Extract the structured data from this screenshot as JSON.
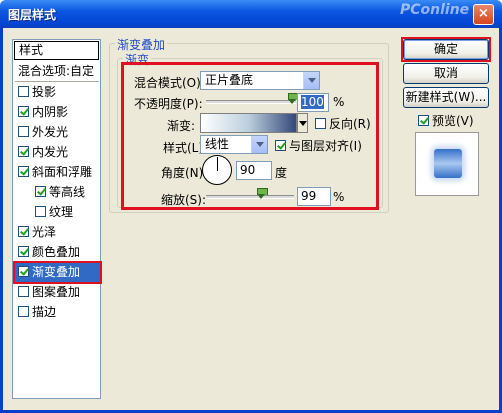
{
  "window": {
    "title": "图层样式",
    "watermark": "PConline",
    "close": "×"
  },
  "sidebar": {
    "header": "样式",
    "blend_options": "混合选项:自定",
    "items": [
      {
        "label": "投影",
        "checked": false
      },
      {
        "label": "内阴影",
        "checked": true
      },
      {
        "label": "外发光",
        "checked": false
      },
      {
        "label": "内发光",
        "checked": true
      },
      {
        "label": "斜面和浮雕",
        "checked": true
      },
      {
        "label": "等高线",
        "checked": true
      },
      {
        "label": "纹理",
        "checked": false
      },
      {
        "label": "光泽",
        "checked": true
      },
      {
        "label": "颜色叠加",
        "checked": true
      },
      {
        "label": "渐变叠加",
        "checked": true,
        "selected": true
      },
      {
        "label": "图案叠加",
        "checked": false
      },
      {
        "label": "描边",
        "checked": false
      }
    ]
  },
  "panel": {
    "outer_legend": "渐变叠加",
    "inner_legend": "渐变",
    "blend_mode_label": "混合模式(O):",
    "blend_mode_value": "正片叠底",
    "opacity_label": "不透明度(P):",
    "opacity_value": "100",
    "opacity_unit": "%",
    "opacity_level": 1.0,
    "gradient_label": "渐变:",
    "reverse_label": "反向(R)",
    "reverse_checked": false,
    "style_label": "样式(L):",
    "style_value": "线性",
    "align_label": "与图层对齐(I)",
    "align_checked": true,
    "angle_label": "角度(N):",
    "angle_value": "90",
    "angle_unit": "度",
    "scale_label": "缩放(S):",
    "scale_value": "99",
    "scale_unit": "%",
    "scale_level": 0.66
  },
  "buttons": {
    "ok": "确定",
    "cancel": "取消",
    "new_style": "新建样式(W)...",
    "preview_label": "预览(V)",
    "preview_checked": true
  },
  "colors": {
    "highlight_red": "#e01020",
    "selection_blue": "#316ac5",
    "legend_blue": "#1f4cc8"
  }
}
